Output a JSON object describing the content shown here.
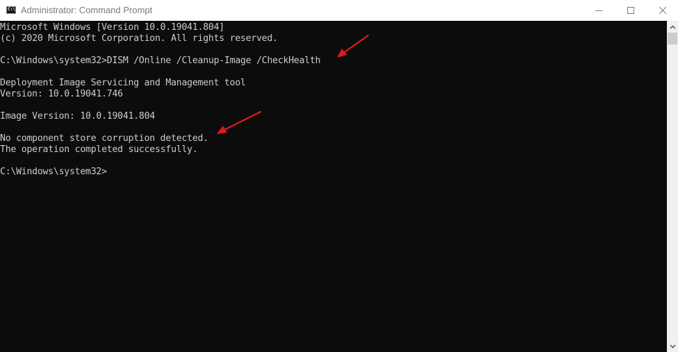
{
  "window": {
    "title": "Administrator: Command Prompt",
    "icon_label": "C:\\",
    "controls": {
      "minimize": "minimize-icon",
      "maximize": "maximize-icon",
      "close": "close-icon"
    }
  },
  "terminal": {
    "lines": [
      "Microsoft Windows [Version 10.0.19041.804]",
      "(c) 2020 Microsoft Corporation. All rights reserved.",
      "",
      "C:\\Windows\\system32>DISM /Online /Cleanup-Image /CheckHealth",
      "",
      "Deployment Image Servicing and Management tool",
      "Version: 10.0.19041.746",
      "",
      "Image Version: 10.0.19041.804",
      "",
      "No component store corruption detected.",
      "The operation completed successfully.",
      "",
      "C:\\Windows\\system32>"
    ],
    "background": "#0c0c0c",
    "foreground": "#cccccc"
  },
  "annotations": {
    "arrow_color": "#e0191b",
    "arrows": [
      {
        "points_to": "DISM command line"
      },
      {
        "points_to": "No component store corruption detected."
      }
    ]
  }
}
